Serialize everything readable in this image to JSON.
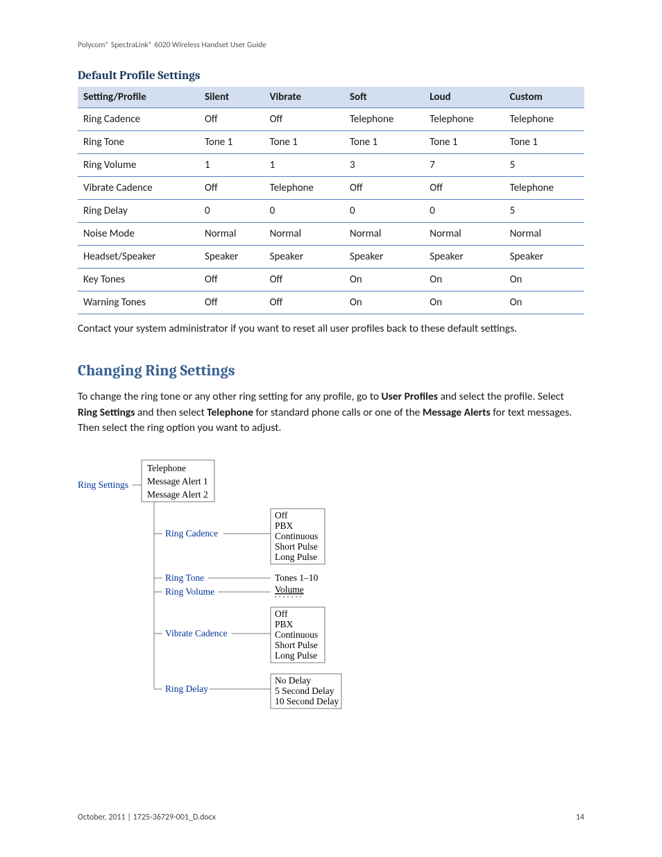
{
  "runningHeader": "Polycom® SpectraLink® 6020 Wireless Handset User Guide",
  "section1": {
    "title": "Default Profile Settings",
    "columns": [
      "Setting/Profile",
      "Silent",
      "Vibrate",
      "Soft",
      "Loud",
      "Custom"
    ],
    "rows": [
      [
        "Ring Cadence",
        "Off",
        "Off",
        "Telephone",
        "Telephone",
        "Telephone"
      ],
      [
        "Ring Tone",
        "Tone 1",
        "Tone 1",
        "Tone 1",
        "Tone 1",
        "Tone 1"
      ],
      [
        "Ring Volume",
        "1",
        "1",
        "3",
        "7",
        "5"
      ],
      [
        "Vibrate Cadence",
        "Off",
        "Telephone",
        "Off",
        "Off",
        "Telephone"
      ],
      [
        "Ring Delay",
        "0",
        "0",
        "0",
        "0",
        "5"
      ],
      [
        "Noise Mode",
        "Normal",
        "Normal",
        "Normal",
        "Normal",
        "Normal"
      ],
      [
        "Headset/Speaker",
        "Speaker",
        "Speaker",
        "Speaker",
        "Speaker",
        "Speaker"
      ],
      [
        "Key Tones",
        "Off",
        "Off",
        "On",
        "On",
        "On"
      ],
      [
        "Warning Tones",
        "Off",
        "Off",
        "On",
        "On",
        "On"
      ]
    ],
    "note": "Contact your system administrator if you want to reset all user profiles back to these default settings."
  },
  "section2": {
    "title": "Changing Ring Settings",
    "paragraph": {
      "t1": "To change the ring tone or any other ring setting for any profile, go to ",
      "b1": "User Profiles",
      "t2": " and select the profile. Select ",
      "b2": "Ring Settings",
      "t3": " and then select ",
      "b3": "Telephone",
      "t4": " for standard phone calls or one of the ",
      "b4": "Message Alerts",
      "t5": " for text messages. Then select the ring option you want to adjust."
    }
  },
  "diagram": {
    "root": "Ring Settings",
    "box1": [
      "Telephone",
      "Message Alert 1",
      "Message Alert 2"
    ],
    "children": [
      {
        "label": "Ring Cadence",
        "options": [
          "Off",
          "PBX",
          "Continuous",
          "Short Pulse",
          "Long Pulse"
        ]
      },
      {
        "label": "Ring Tone",
        "options": [
          "Tones 1–10"
        ]
      },
      {
        "label": "Ring Volume",
        "options": [
          "Volume"
        ]
      },
      {
        "label": "Vibrate Cadence",
        "options": [
          "Off",
          "PBX",
          "Continuous",
          "Short Pulse",
          "Long Pulse"
        ]
      },
      {
        "label": "Ring Delay",
        "options": [
          "No Delay",
          "5 Second Delay",
          "10 Second Delay"
        ]
      }
    ]
  },
  "footer": {
    "left": "October, 2011   |   1725-36729-001_D.docx",
    "right": "14"
  }
}
